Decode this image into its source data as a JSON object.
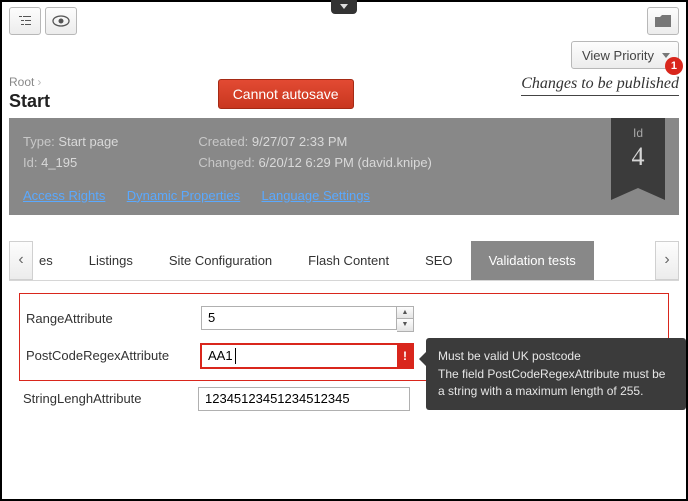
{
  "top": {
    "view_priority": "View Priority"
  },
  "breadcrumb": {
    "root": "Root"
  },
  "title": "Start",
  "alert": "Cannot autosave",
  "changes": {
    "count": "1",
    "text": "Changes to be published"
  },
  "meta": {
    "type_label": "Type:",
    "type_value": "Start page",
    "id_label": "Id:",
    "id_value": "4_195",
    "created_label": "Created:",
    "created_value": "9/27/07 2:33 PM",
    "changed_label": "Changed:",
    "changed_value": "6/20/12 6:29 PM (david.knipe)",
    "links": {
      "access": "Access Rights",
      "dynamic": "Dynamic Properties",
      "lang": "Language Settings"
    },
    "ribbon_label": "Id",
    "ribbon_value": "4"
  },
  "tabs": {
    "t0": "es",
    "t1": "Listings",
    "t2": "Site Configuration",
    "t3": "Flash Content",
    "t4": "SEO",
    "t5": "Validation tests"
  },
  "form": {
    "range": {
      "label": "RangeAttribute",
      "value": "5"
    },
    "postcode": {
      "label": "PostCodeRegexAttribute",
      "value": "AA1"
    },
    "strlen": {
      "label": "StringLenghAttribute",
      "value": "12345123451234512345"
    }
  },
  "tooltip": {
    "line1": "Must be valid UK postcode",
    "line2": "The field PostCodeRegexAttribute must be a string with a maximum length of 255."
  }
}
